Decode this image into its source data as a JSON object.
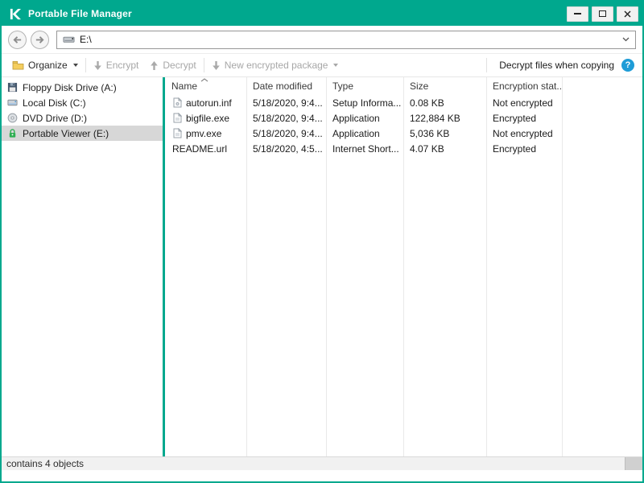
{
  "window": {
    "title": "Portable File Manager"
  },
  "navbar": {
    "address": "E:\\"
  },
  "toolbar": {
    "organize_label": "Organize",
    "encrypt_label": "Encrypt",
    "decrypt_label": "Decrypt",
    "new_package_label": "New encrypted package",
    "decrypt_copy_label": "Decrypt files when copying",
    "help_glyph": "?"
  },
  "sidebar": {
    "items": [
      {
        "label": "Floppy Disk Drive (A:)",
        "icon": "floppy-disk-icon"
      },
      {
        "label": "Local Disk (C:)",
        "icon": "hard-disk-icon"
      },
      {
        "label": "DVD Drive (D:)",
        "icon": "dvd-disc-icon"
      },
      {
        "label": "Portable Viewer (E:)",
        "icon": "green-lock-icon",
        "selected": true
      }
    ]
  },
  "filelist": {
    "columns": {
      "name": "Name",
      "date": "Date modified",
      "type": "Type",
      "size": "Size",
      "encryption": "Encryption stat..."
    },
    "rows": [
      {
        "name": "autorun.inf",
        "date": "5/18/2020, 9:4...",
        "type": "Setup Informa...",
        "size": "0.08 KB",
        "encryption": "Not encrypted"
      },
      {
        "name": "bigfile.exe",
        "date": "5/18/2020, 9:4...",
        "type": "Application",
        "size": "122,884 KB",
        "encryption": "Encrypted"
      },
      {
        "name": "pmv.exe",
        "date": "5/18/2020, 9:4...",
        "type": "Application",
        "size": "5,036 KB",
        "encryption": "Not encrypted"
      },
      {
        "name": "README.url",
        "date": "5/18/2020, 4:5...",
        "type": "Internet Short...",
        "size": "4.07 KB",
        "encryption": "Encrypted"
      }
    ]
  },
  "statusbar": {
    "text": "contains 4 objects"
  },
  "colors": {
    "brand_green": "#00a88e",
    "help_blue": "#1e9cd7",
    "selection_gray": "#d7d7d7"
  }
}
